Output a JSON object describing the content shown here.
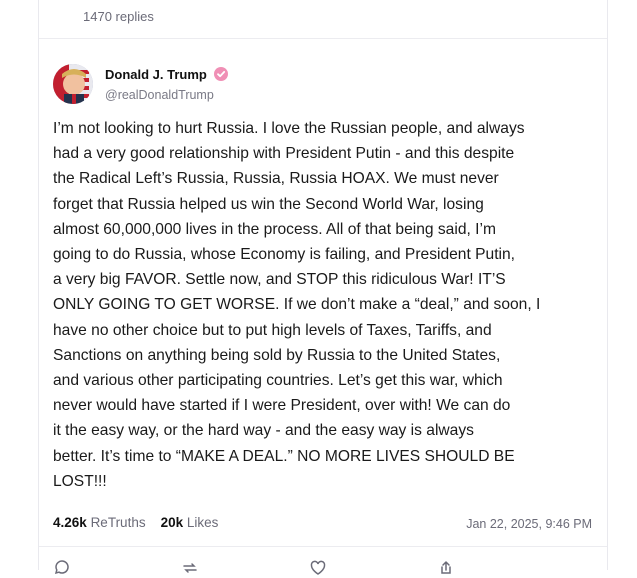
{
  "replies_header": {
    "count_text": "1470 replies"
  },
  "post": {
    "author_name": "Donald J. Trump",
    "author_handle": "@realDonaldTrump",
    "text": "I’m not looking to hurt Russia. I love the Russian people, and always\nhad a very good relationship with President Putin - and this despite\nthe Radical Left’s Russia, Russia, Russia HOAX. We must never\nforget that Russia helped us win the Second World War, losing\nalmost 60,000,000 lives in the process. All of that being said, I’m\ngoing to do Russia, whose Economy is failing, and President Putin,\na very big FAVOR. Settle now, and STOP this ridiculous War! IT’S\nONLY GOING TO GET WORSE. If we don’t make a “deal,” and soon, I\nhave no other choice but to put high levels of Taxes, Tariffs, and\nSanctions on anything being sold by Russia to the United States,\nand various other participating countries. Let’s get this war, which\nnever would have started if I were President, over with! We can do\nit the easy way, or the hard way - and the easy way is always\nbetter. It’s time to “MAKE A DEAL.” NO MORE LIVES SHOULD BE\nLOST!!!",
    "retruths_count": "4.26k",
    "retruths_label": "ReTruths",
    "likes_count": "20k",
    "likes_label": "Likes",
    "timestamp": "Jan 22, 2025, 9:46 PM"
  },
  "colors": {
    "verified_badge": "#f08fb5",
    "muted_text": "#6b6b78"
  },
  "icons": [
    "verified-badge-icon",
    "reply-icon",
    "retruth-icon",
    "like-icon",
    "share-icon"
  ]
}
